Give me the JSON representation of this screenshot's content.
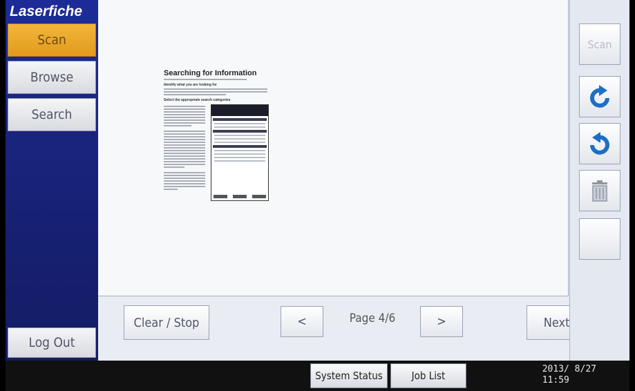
{
  "app": {
    "logo": "Laserfiche"
  },
  "sidebar": {
    "items": [
      {
        "label": "Scan",
        "active": true
      },
      {
        "label": "Browse",
        "active": false
      },
      {
        "label": "Search",
        "active": false
      }
    ],
    "logout_label": "Log Out"
  },
  "preview": {
    "doc_title": "Searching for Information",
    "heading1": "Identify what you are looking for",
    "heading2": "Select the appropriate search categories"
  },
  "controls": {
    "clear_label": "Clear / Stop",
    "prev_label": "<",
    "page_label": "Page 4/6",
    "next_page_label": ">",
    "next_label": "Next >"
  },
  "right_panel": {
    "scan_label": "Scan",
    "icons": [
      "rotate-clockwise-icon",
      "rotate-counterclockwise-icon",
      "trash-icon"
    ]
  },
  "statusbar": {
    "system_status_label": "System Status",
    "job_list_label": "Job List",
    "date": "2013/ 8/27",
    "time": "11:59"
  },
  "colors": {
    "sidebar_blue": "#172174",
    "active_orange": "#e9a429",
    "rotate_blue": "#1e6fc4"
  }
}
